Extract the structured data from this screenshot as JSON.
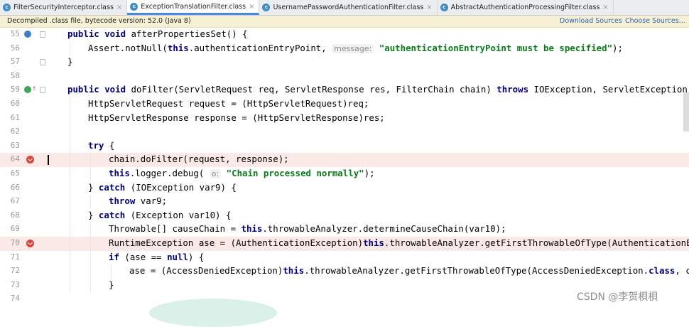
{
  "tabs": [
    {
      "label": "FilterSecurityInterceptor.class",
      "icon": "class-file-icon",
      "active": false
    },
    {
      "label": "ExceptionTranslationFilter.class",
      "icon": "class-file-icon",
      "active": true
    },
    {
      "label": "UsernamePasswordAuthenticationFilter.class",
      "icon": "class-file-icon",
      "active": false
    },
    {
      "label": "AbstractAuthenticationProcessingFilter.class",
      "icon": "class-file-icon",
      "active": false
    }
  ],
  "tab_icon_letter": "c",
  "tab_close_glyph": "×",
  "banner": {
    "text": "Decompiled .class file, bytecode version: 52.0 (Java 8)",
    "download_sources": "Download Sources",
    "choose_sources": "Choose Sources..."
  },
  "lines": [
    {
      "num": "55",
      "text": "public void afterPropertiesSet() {"
    },
    {
      "num": "56",
      "text": "Assert.notNull(this.authenticationEntryPoint, message: \"authenticationEntryPoint must be specified\");"
    },
    {
      "num": "57",
      "text": "}"
    },
    {
      "num": "58",
      "text": ""
    },
    {
      "num": "59",
      "text": "public void doFilter(ServletRequest req, ServletResponse res, FilterChain chain) throws IOException, ServletException {"
    },
    {
      "num": "60",
      "text": "HttpServletRequest request = (HttpServletRequest)req;"
    },
    {
      "num": "61",
      "text": "HttpServletResponse response = (HttpServletResponse)res;"
    },
    {
      "num": "62",
      "text": ""
    },
    {
      "num": "63",
      "text": "try {"
    },
    {
      "num": "64",
      "text": "chain.doFilter(request, response);"
    },
    {
      "num": "65",
      "text": "this.logger.debug( o: \"Chain processed normally\");"
    },
    {
      "num": "66",
      "text": "} catch (IOException var9) {"
    },
    {
      "num": "67",
      "text": "throw var9;"
    },
    {
      "num": "68",
      "text": "} catch (Exception var10) {"
    },
    {
      "num": "69",
      "text": "Throwable[] causeChain = this.throwableAnalyzer.determineCauseChain(var10);"
    },
    {
      "num": "70",
      "text": "RuntimeException ase = (AuthenticationException)this.throwableAnalyzer.getFirstThrowableOfType(AuthenticationExc"
    },
    {
      "num": "71",
      "text": "if (ase == null) {"
    },
    {
      "num": "72",
      "text": "ase = (AccessDeniedException)this.throwableAnalyzer.getFirstThrowableOfType(AccessDeniedException.class, cau"
    },
    {
      "num": "73",
      "text": "}"
    },
    {
      "num": "74",
      "text": ""
    }
  ],
  "breakpoint_lines": [
    "64",
    "70"
  ],
  "current_line": "64",
  "watermark": "CSDN @李贺梖梖",
  "colors": {
    "keyword": "#000080",
    "string": "#067d17",
    "breakpoint_bg": "#fae9e6",
    "active_tab_underline": "#4a86e8",
    "banner_bg": "#f6f1d5",
    "link": "#2d62b8"
  }
}
